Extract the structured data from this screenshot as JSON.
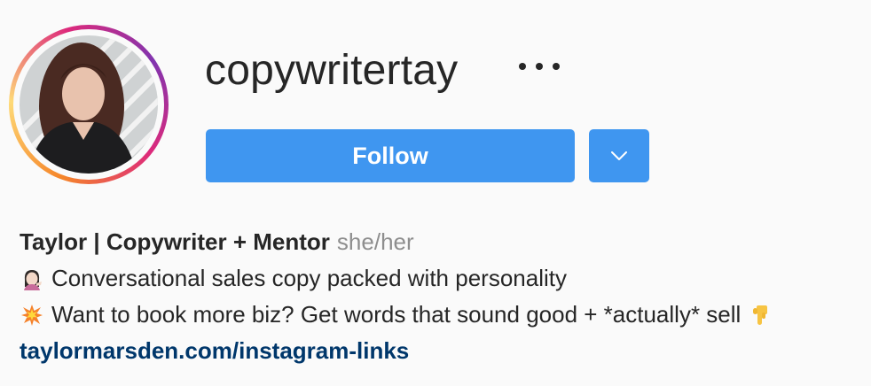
{
  "profile": {
    "username": "copywritertay",
    "follow_label": "Follow",
    "full_name": "Taylor | Copywriter + Mentor",
    "pronouns": "she/her",
    "bio_lines": [
      "Conversational sales copy packed with personality",
      "Want to book more biz? Get words that sound good + *actually* sell"
    ],
    "link": "taylormarsden.com/instagram-links"
  },
  "icons": {
    "more": "more-options-icon",
    "dropdown": "chevron-down-icon",
    "emoji_1": "woman-tipping-hand-emoji",
    "emoji_2": "collision-emoji",
    "emoji_3": "backhand-index-pointing-down-emoji"
  },
  "colors": {
    "background": "#fafafa",
    "button": "#3f96f0",
    "link": "#00376b",
    "secondary_text": "#8e8e8e",
    "primary_text": "#262626"
  }
}
